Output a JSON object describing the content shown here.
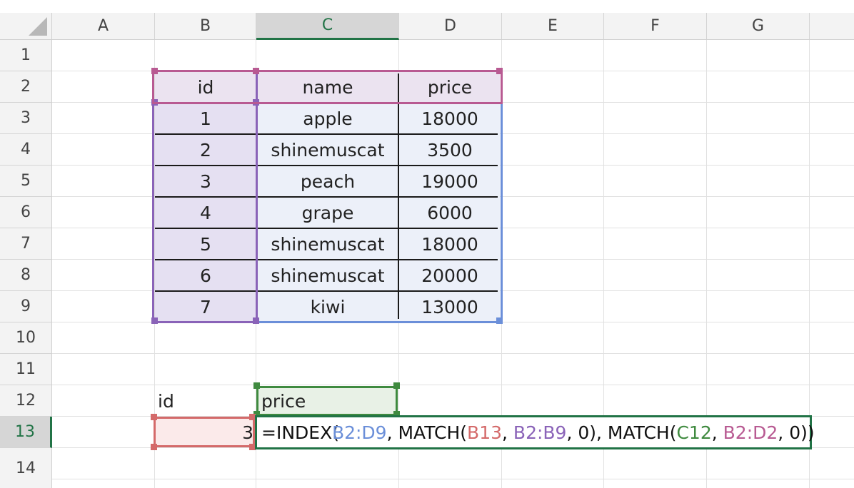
{
  "columns": [
    "A",
    "B",
    "C",
    "D",
    "E",
    "F",
    "G"
  ],
  "rows": [
    "1",
    "2",
    "3",
    "4",
    "5",
    "6",
    "7",
    "8",
    "9",
    "10",
    "11",
    "12",
    "13",
    "14"
  ],
  "selected_column": "C",
  "selected_row": "13",
  "table": {
    "headers": {
      "id": "id",
      "name": "name",
      "price": "price"
    },
    "rows": [
      {
        "id": "1",
        "name": "apple",
        "price": "18000"
      },
      {
        "id": "2",
        "name": "shinemuscat",
        "price": "3500"
      },
      {
        "id": "3",
        "name": "peach",
        "price": "19000"
      },
      {
        "id": "4",
        "name": "grape",
        "price": "6000"
      },
      {
        "id": "5",
        "name": "shinemuscat",
        "price": "18000"
      },
      {
        "id": "6",
        "name": "shinemuscat",
        "price": "20000"
      },
      {
        "id": "7",
        "name": "kiwi",
        "price": "13000"
      }
    ]
  },
  "lookup": {
    "id_label": "id",
    "price_label": "price",
    "id_value": "3"
  },
  "formula": {
    "t1": "=INDEX(",
    "t2": "B2:D9",
    "t3": ", MATCH(",
    "t4": "B13",
    "t5": ", ",
    "t6": "B2:B9",
    "t7": ", 0), MATCH(",
    "t8": "C12",
    "t9": ", ",
    "t10": "B2:D2",
    "t11": ", 0))"
  },
  "colors": {
    "blue_range": "#6b8fd9",
    "red_range": "#d46a6a",
    "purple_range": "#8a63b8",
    "green_range": "#3f8a3f",
    "magenta_range": "#b85a92",
    "selection_green": "#217346"
  }
}
